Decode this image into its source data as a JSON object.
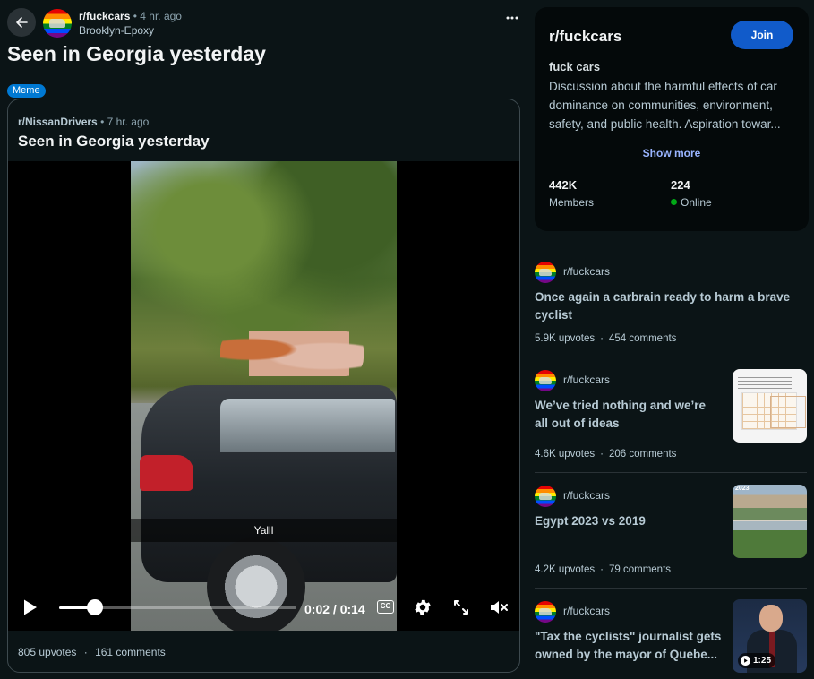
{
  "header": {
    "subreddit": "r/fuckcars",
    "time": "4 hr. ago",
    "username": "Brooklyn-Epoxy",
    "title": "Seen in Georgia yesterday",
    "flair": "Meme"
  },
  "crosspost": {
    "subreddit": "r/NissanDrivers",
    "time": "7 hr. ago",
    "title": "Seen in Georgia yesterday",
    "video": {
      "caption": "Yalll",
      "time": "0:02 / 0:14",
      "progress_fraction": 0.15,
      "cc_label": "CC"
    },
    "upvotes": "805 upvotes",
    "comments": "161 comments"
  },
  "sidebar": {
    "name": "r/fuckcars",
    "join_label": "Join",
    "tagline": "fuck cars",
    "description": "Discussion about the harmful effects of car dominance on communities, environment, safety, and public health. Aspiration towar...",
    "show_more": "Show more",
    "members_count": "442K",
    "members_label": "Members",
    "online_count": "224",
    "online_label": "Online"
  },
  "related": [
    {
      "subreddit": "r/fuckcars",
      "title": "Once again a carbrain ready to harm a brave cyclist",
      "upvotes": "5.9K upvotes",
      "comments": "454 comments"
    },
    {
      "subreddit": "r/fuckcars",
      "title": "We’ve tried nothing and we’re all out of ideas",
      "upvotes": "4.6K upvotes",
      "comments": "206 comments"
    },
    {
      "subreddit": "r/fuckcars",
      "title": "Egypt 2023 vs 2019",
      "upvotes": "4.2K upvotes",
      "comments": "79 comments",
      "thumb_label": "2023"
    },
    {
      "subreddit": "r/fuckcars",
      "title": "\"Tax the cyclists\" journalist gets owned by the mayor of Quebe...",
      "video_length": "1:25"
    }
  ],
  "separator": "·",
  "colors": {
    "accent": "#115bca",
    "flair": "#0079d3",
    "online": "#01a816",
    "background": "#0b1416"
  }
}
